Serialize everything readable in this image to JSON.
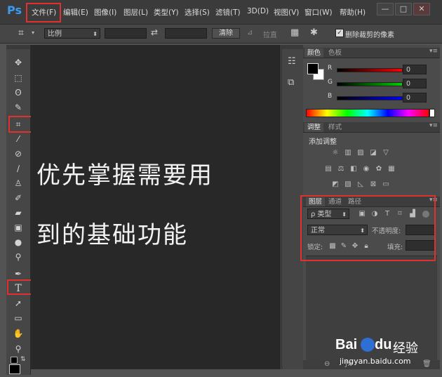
{
  "app": {
    "logo": "Ps"
  },
  "menu": [
    "文件(F)",
    "编辑(E)",
    "图像(I)",
    "图层(L)",
    "类型(Y)",
    "选择(S)",
    "滤镜(T)",
    "3D(D)",
    "视图(V)",
    "窗口(W)",
    "帮助(H)"
  ],
  "window_controls": {
    "minimize": "—",
    "restore": "□",
    "close": "✕"
  },
  "options_bar": {
    "ratio_select": "比例",
    "clear_button": "清除",
    "straighten_label": "拉直",
    "delete_cropped_label": "删除裁剪的像素",
    "delete_cropped_checked": true
  },
  "canvas_text": {
    "line1": "优先掌握需要用",
    "line2": "到的基础功能"
  },
  "color_panel": {
    "tabs": [
      "颜色",
      "色板"
    ],
    "rows": [
      {
        "label": "R",
        "value": "0"
      },
      {
        "label": "G",
        "value": "0"
      },
      {
        "label": "B",
        "value": "0"
      }
    ]
  },
  "adjustments_panel": {
    "tabs": [
      "调整",
      "样式"
    ],
    "title": "添加调整"
  },
  "layers_panel": {
    "tabs": [
      "图层",
      "通道",
      "路径"
    ],
    "filter_kind": "ρ 类型",
    "blend_mode": "正常",
    "opacity_label": "不透明度:",
    "lock_label": "锁定:",
    "fill_label": "填充:"
  },
  "watermark": {
    "brand": "Bai",
    "brand2": "du",
    "suffix": "经验",
    "url": "jingyan.baidu.com"
  },
  "colors": {
    "accent_red": "#e03030",
    "ps_blue": "#3a9cf0"
  }
}
